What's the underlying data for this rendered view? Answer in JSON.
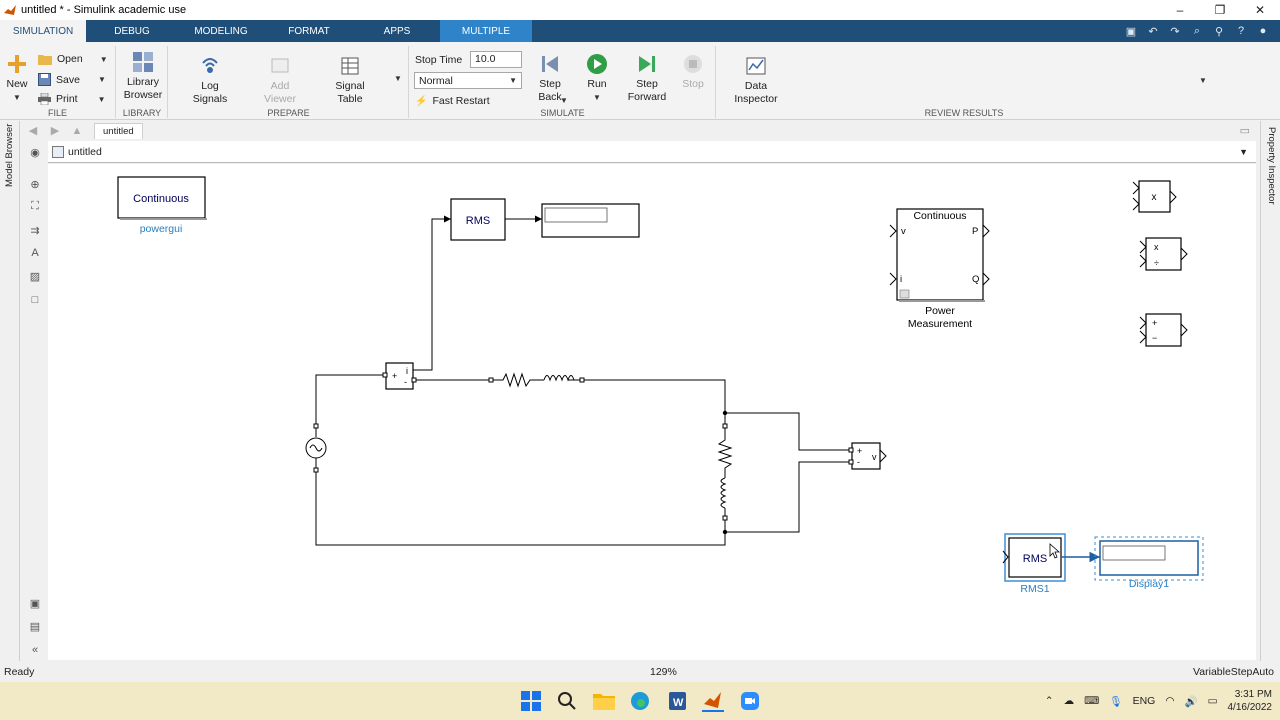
{
  "window": {
    "title": "untitled * - Simulink academic use",
    "controls": [
      "–",
      "❐",
      "✕"
    ]
  },
  "tabs": [
    {
      "label": "SIMULATION",
      "active": true
    },
    {
      "label": "DEBUG"
    },
    {
      "label": "MODELING"
    },
    {
      "label": "FORMAT"
    },
    {
      "label": "APPS"
    },
    {
      "label": "MULTIPLE"
    }
  ],
  "ribbon": {
    "file": {
      "label": "FILE",
      "new": "New",
      "open": "Open",
      "save": "Save",
      "print": "Print"
    },
    "library": {
      "label": "LIBRARY",
      "library_browser_line1": "Library",
      "library_browser_line2": "Browser"
    },
    "prepare": {
      "label": "PREPARE",
      "log_signals_line1": "Log",
      "log_signals_line2": "Signals",
      "add_viewer_line1": "Add",
      "add_viewer_line2": "Viewer",
      "signal_table_line1": "Signal",
      "signal_table_line2": "Table"
    },
    "simulate": {
      "label": "SIMULATE",
      "stop_time_label": "Stop Time",
      "stop_time_value": "10.0",
      "mode": "Normal",
      "fast_restart": "Fast Restart",
      "step_back_line1": "Step",
      "step_back_line2": "Back",
      "run": "Run",
      "step_forward_line1": "Step",
      "step_forward_line2": "Forward",
      "stop": "Stop"
    },
    "review": {
      "label": "REVIEW RESULTS",
      "data_inspector_line1": "Data",
      "data_inspector_line2": "Inspector"
    }
  },
  "side": {
    "model_browser": "Model Browser",
    "property_inspector": "Property Inspector"
  },
  "breadcrumb": {
    "tab": "untitled"
  },
  "address": {
    "path": "untitled"
  },
  "blocks": {
    "powergui_text": "Continuous",
    "powergui_label": "powergui",
    "rms_text": "RMS",
    "power_meas_title": "Continuous",
    "power_meas_v": "v",
    "power_meas_i": "i",
    "power_meas_p": "P",
    "power_meas_q": "Q",
    "power_meas_label_line1": "Power",
    "power_meas_label_line2": "Measurement",
    "product_text": "x",
    "divide_top": "x",
    "divide_bottom": "÷",
    "sum_top": "+",
    "sum_bottom": "−",
    "current_meas_plus": "+",
    "current_meas_minus": "-",
    "current_meas_i": "i",
    "voltage_meas_plus": "+",
    "voltage_meas_minus": "-",
    "voltage_meas_v": "v",
    "rms1_text": "RMS",
    "rms1_label": "RMS1",
    "display1_label": "Display1"
  },
  "status": {
    "ready": "Ready",
    "zoom": "129%",
    "solver": "VariableStepAuto"
  },
  "taskbar": {
    "lang": "ENG",
    "time": "3:31 PM",
    "date": "4/16/2022"
  },
  "colors": {
    "ribbon_blue": "#1f4e79",
    "active_tab": "#2f83c9",
    "selected": "#3a8fd6",
    "label_blue": "#2a7fc1",
    "taskbar": "#f2e9c7"
  }
}
